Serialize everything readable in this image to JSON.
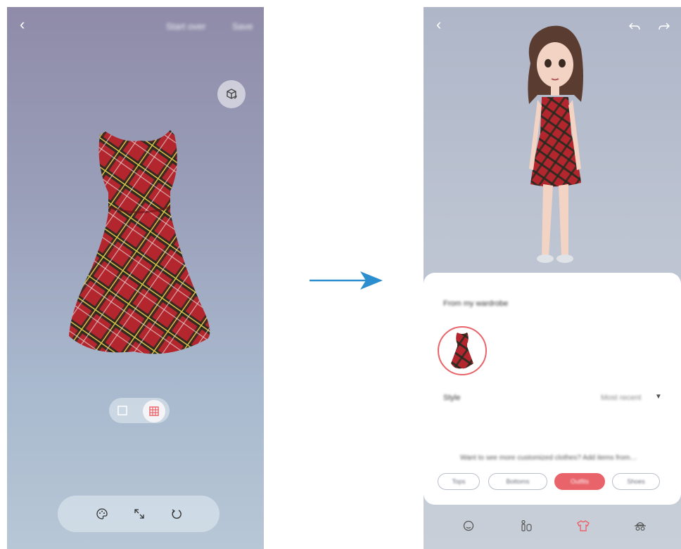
{
  "left_screen": {
    "start_over_label": "Start over",
    "save_label": "Save",
    "view_toggle": [
      "plain-view",
      "pattern-view"
    ],
    "tools": [
      "palette-icon",
      "resize-icon",
      "rotate-icon"
    ]
  },
  "right_screen": {
    "wardrobe_title": "From my wardrobe",
    "style_label": "Style",
    "style_value": "Most recent",
    "hint_text": "Want to see more customized clothes? Add items from…",
    "categories": [
      {
        "label": "Tops",
        "active": false
      },
      {
        "label": "Bottoms",
        "active": false
      },
      {
        "label": "Outfits",
        "active": true
      },
      {
        "label": "Shoes",
        "active": false
      }
    ],
    "nav": [
      "face-icon",
      "body-icon",
      "clothing-icon",
      "accessory-icon"
    ]
  },
  "colors": {
    "accent": "#e9636a",
    "arrow": "#2b8fcf"
  }
}
